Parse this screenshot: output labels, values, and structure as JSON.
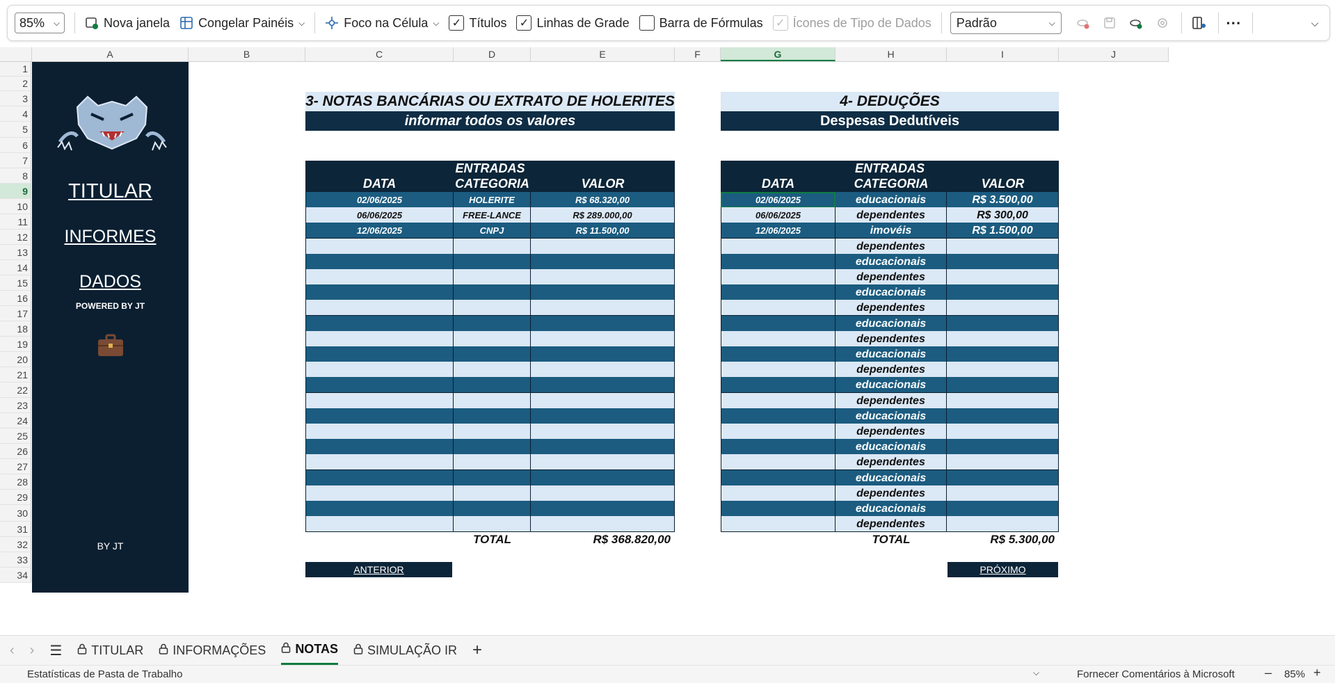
{
  "ribbon": {
    "zoom": "85%",
    "new_window": "Nova janela",
    "freeze_panes": "Congelar Painéis",
    "focus_cell": "Foco na Célula",
    "headings": "Títulos",
    "gridlines": "Linhas de Grade",
    "formula_bar": "Barra de Fórmulas",
    "data_type_icons": "Ícones de Tipo de Dados",
    "cell_style": "Padrão"
  },
  "columns": [
    "A",
    "B",
    "C",
    "D",
    "E",
    "F",
    "G",
    "H",
    "I",
    "J"
  ],
  "rows": [
    "1",
    "2",
    "3",
    "4",
    "5",
    "6",
    "7",
    "8",
    "9",
    "10",
    "11",
    "12",
    "13",
    "14",
    "15",
    "16",
    "17",
    "18",
    "19",
    "20",
    "21",
    "22",
    "23",
    "24",
    "25",
    "26",
    "27",
    "28",
    "29",
    "30",
    "31",
    "32",
    "33",
    "34"
  ],
  "sidebar": {
    "titular": "TITULAR",
    "informes": "INFORMES",
    "dados": "DADOS",
    "powered": "POWERED BY JT",
    "by": "BY JT"
  },
  "notas": {
    "title": "3- NOTAS BANCÁRIAS OU EXTRATO DE HOLERITES",
    "subtitle": "informar todos os valores",
    "section": "ENTRADAS",
    "headers": [
      "DATA",
      "CATEGORIA",
      "VALOR"
    ],
    "rows": [
      [
        "02/06/2025",
        "HOLERITE",
        "R$ 68.320,00"
      ],
      [
        "06/06/2025",
        "FREE-LANCE",
        "R$ 289.000,00"
      ],
      [
        "12/06/2025",
        "CNPJ",
        "R$ 11.500,00"
      ]
    ],
    "total_label": "TOTAL",
    "total_value": "R$ 368.820,00",
    "prev_button": "ANTERIOR"
  },
  "deducoes": {
    "title": "4- DEDUÇÕES",
    "subtitle": "Despesas Dedutíveis",
    "section": "ENTRADAS",
    "headers": [
      "DATA",
      "CATEGORIA",
      "VALOR"
    ],
    "rows": [
      [
        "02/06/2025",
        "educacionais",
        "R$ 3.500,00"
      ],
      [
        "06/06/2025",
        "dependentes",
        "R$ 300,00"
      ],
      [
        "12/06/2025",
        "imovéis",
        "R$ 1.500,00"
      ]
    ],
    "filler": [
      "dependentes",
      "educacionais",
      "dependentes",
      "educacionais",
      "dependentes",
      "educacionais",
      "dependentes",
      "educacionais",
      "dependentes",
      "educacionais",
      "dependentes",
      "educacionais",
      "dependentes",
      "educacionais",
      "dependentes",
      "educacionais",
      "dependentes",
      "educacionais",
      "dependentes"
    ],
    "total_label": "TOTAL",
    "total_value": "R$ 5.300,00",
    "next_button": "PRÓXIMO"
  },
  "sheet_tabs": [
    {
      "label": "TITULAR",
      "active": false
    },
    {
      "label": "INFORMAÇÕES",
      "active": false
    },
    {
      "label": "NOTAS",
      "active": true
    },
    {
      "label": "SIMULAÇÃO IR",
      "active": false
    }
  ],
  "status": {
    "left": "Estatísticas de Pasta de Trabalho",
    "feedback": "Fornecer Comentários à Microsoft",
    "zoom": "85%"
  },
  "colors": {
    "navy": "#0b1f31",
    "row_dark": "#1b5c80",
    "row_light": "#dbe8f5",
    "accent_green": "#107c41"
  }
}
